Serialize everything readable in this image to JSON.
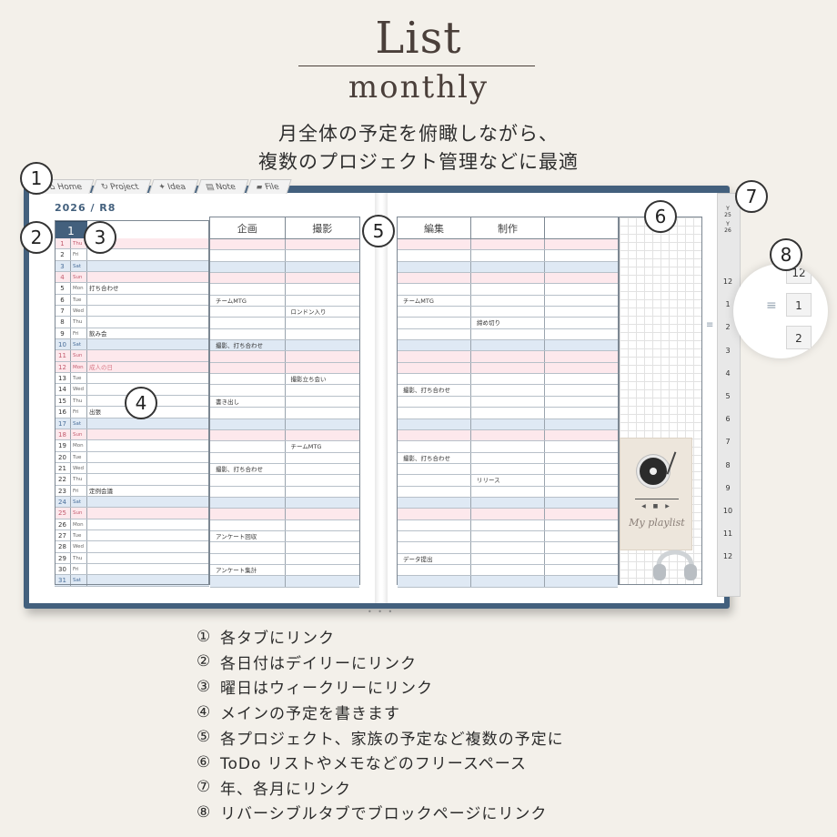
{
  "header": {
    "title": "List",
    "subtitle": "monthly",
    "lead_line1": "月全体の予定を俯瞰しながら、",
    "lead_line2": "複数のプロジェクト管理などに最適"
  },
  "tabs": [
    {
      "label": "Home",
      "icon": "home-icon",
      "glyph": "⌂"
    },
    {
      "label": "Project",
      "icon": "sync-icon",
      "glyph": "↻"
    },
    {
      "label": "Idea",
      "icon": "bulb-icon",
      "glyph": "✦"
    },
    {
      "label": "Note",
      "icon": "clipboard-icon",
      "glyph": "▤"
    },
    {
      "label": "File",
      "icon": "folder-icon",
      "glyph": "▰"
    }
  ],
  "planner": {
    "year_label": "2026 / R8",
    "month": "1",
    "project_headers_left": [
      "企画",
      "撮影"
    ],
    "project_headers_right": [
      "編集",
      "制作",
      ""
    ],
    "days": [
      {
        "d": "1",
        "w": "Thu",
        "t": "",
        "k": "sun"
      },
      {
        "d": "2",
        "w": "Fri",
        "t": "",
        "k": ""
      },
      {
        "d": "3",
        "w": "Sat",
        "t": "",
        "k": "sat"
      },
      {
        "d": "4",
        "w": "Sun",
        "t": "",
        "k": "sun"
      },
      {
        "d": "5",
        "w": "Mon",
        "t": "打ち合わせ",
        "k": ""
      },
      {
        "d": "6",
        "w": "Tue",
        "t": "",
        "k": ""
      },
      {
        "d": "7",
        "w": "Wed",
        "t": "",
        "k": ""
      },
      {
        "d": "8",
        "w": "Thu",
        "t": "",
        "k": ""
      },
      {
        "d": "9",
        "w": "Fri",
        "t": "飲み会",
        "k": ""
      },
      {
        "d": "10",
        "w": "Sat",
        "t": "",
        "k": "sat"
      },
      {
        "d": "11",
        "w": "Sun",
        "t": "",
        "k": "sun"
      },
      {
        "d": "12",
        "w": "Mon",
        "t": "成人の日",
        "k": "sun red"
      },
      {
        "d": "13",
        "w": "Tue",
        "t": "",
        "k": ""
      },
      {
        "d": "14",
        "w": "Wed",
        "t": "",
        "k": ""
      },
      {
        "d": "15",
        "w": "Thu",
        "t": "",
        "k": ""
      },
      {
        "d": "16",
        "w": "Fri",
        "t": "出張",
        "k": ""
      },
      {
        "d": "17",
        "w": "Sat",
        "t": "",
        "k": "sat"
      },
      {
        "d": "18",
        "w": "Sun",
        "t": "",
        "k": "sun"
      },
      {
        "d": "19",
        "w": "Mon",
        "t": "",
        "k": ""
      },
      {
        "d": "20",
        "w": "Tue",
        "t": "",
        "k": ""
      },
      {
        "d": "21",
        "w": "Wed",
        "t": "",
        "k": ""
      },
      {
        "d": "22",
        "w": "Thu",
        "t": "",
        "k": ""
      },
      {
        "d": "23",
        "w": "Fri",
        "t": "定例会議",
        "k": ""
      },
      {
        "d": "24",
        "w": "Sat",
        "t": "",
        "k": "sat"
      },
      {
        "d": "25",
        "w": "Sun",
        "t": "",
        "k": "sun"
      },
      {
        "d": "26",
        "w": "Mon",
        "t": "",
        "k": ""
      },
      {
        "d": "27",
        "w": "Tue",
        "t": "",
        "k": ""
      },
      {
        "d": "28",
        "w": "Wed",
        "t": "",
        "k": ""
      },
      {
        "d": "29",
        "w": "Thu",
        "t": "",
        "k": ""
      },
      {
        "d": "30",
        "w": "Fri",
        "t": "",
        "k": ""
      },
      {
        "d": "31",
        "w": "Sat",
        "t": "",
        "k": "sat"
      }
    ],
    "left_entries": [
      [
        "",
        ""
      ],
      [
        "",
        ""
      ],
      [
        "",
        ""
      ],
      [
        "",
        ""
      ],
      [
        "",
        ""
      ],
      [
        "チームMTG",
        ""
      ],
      [
        "",
        "ロンドン入り"
      ],
      [
        "",
        ""
      ],
      [
        "",
        ""
      ],
      [
        "撮影、打ち合わせ",
        ""
      ],
      [
        "",
        ""
      ],
      [
        "",
        ""
      ],
      [
        "",
        "撮影立ち会い"
      ],
      [
        "",
        ""
      ],
      [
        "書き出し",
        ""
      ],
      [
        "",
        ""
      ],
      [
        "",
        ""
      ],
      [
        "",
        ""
      ],
      [
        "",
        "チームMTG"
      ],
      [
        "",
        ""
      ],
      [
        "撮影、打ち合わせ",
        ""
      ],
      [
        "",
        ""
      ],
      [
        "",
        ""
      ],
      [
        "",
        ""
      ],
      [
        "",
        ""
      ],
      [
        "",
        ""
      ],
      [
        "アンケート回収",
        ""
      ],
      [
        "",
        ""
      ],
      [
        "",
        ""
      ],
      [
        "アンケート集計",
        ""
      ],
      [
        "",
        ""
      ]
    ],
    "right_entries": [
      [
        "",
        "",
        ""
      ],
      [
        "",
        "",
        ""
      ],
      [
        "",
        "",
        ""
      ],
      [
        "",
        "",
        ""
      ],
      [
        "",
        "",
        ""
      ],
      [
        "チームMTG",
        "",
        ""
      ],
      [
        "",
        "",
        ""
      ],
      [
        "",
        "締め切り",
        ""
      ],
      [
        "",
        "",
        ""
      ],
      [
        "",
        "",
        ""
      ],
      [
        "",
        "",
        ""
      ],
      [
        "",
        "",
        ""
      ],
      [
        "",
        "",
        ""
      ],
      [
        "撮影、打ち合わせ",
        "",
        ""
      ],
      [
        "",
        "",
        ""
      ],
      [
        "",
        "",
        ""
      ],
      [
        "",
        "",
        ""
      ],
      [
        "",
        "",
        ""
      ],
      [
        "",
        "",
        ""
      ],
      [
        "撮影、打ち合わせ",
        "",
        ""
      ],
      [
        "",
        "",
        ""
      ],
      [
        "",
        "リリース",
        ""
      ],
      [
        "",
        "",
        ""
      ],
      [
        "",
        "",
        ""
      ],
      [
        "",
        "",
        ""
      ],
      [
        "",
        "",
        ""
      ],
      [
        "",
        "",
        ""
      ],
      [
        "",
        "",
        ""
      ],
      [
        "データ提出",
        "",
        ""
      ],
      [
        "",
        "",
        ""
      ],
      [
        "",
        "",
        ""
      ]
    ],
    "playlist_label": "My playlist",
    "player_controls": "◀ ■ ▶"
  },
  "side_tabs": {
    "year_tabs": [
      "Y\n25",
      "Y\n26"
    ],
    "months": [
      "12",
      "1",
      "2",
      "3",
      "4",
      "5",
      "6",
      "7",
      "8",
      "9",
      "10",
      "11",
      "12"
    ],
    "menu_icon": "≡"
  },
  "zoom": {
    "tabs": [
      "12",
      "1",
      "2"
    ],
    "menu_icon": "≡"
  },
  "markers": [
    "1",
    "2",
    "3",
    "4",
    "5",
    "6",
    "7",
    "8"
  ],
  "features": [
    {
      "n": "①",
      "text": "各タブにリンク"
    },
    {
      "n": "②",
      "text": "各日付はデイリーにリンク"
    },
    {
      "n": "③",
      "text": "曜日はウィークリーにリンク"
    },
    {
      "n": "④",
      "text": "メインの予定を書きます"
    },
    {
      "n": "⑤",
      "text": "各プロジェクト、家族の予定など複数の予定に"
    },
    {
      "n": "⑥",
      "text": "ToDo リストやメモなどのフリースペース"
    },
    {
      "n": "⑦",
      "text": "年、各月にリンク"
    },
    {
      "n": "⑧",
      "text": "リバーシブルタブでブロックページにリンク"
    }
  ]
}
